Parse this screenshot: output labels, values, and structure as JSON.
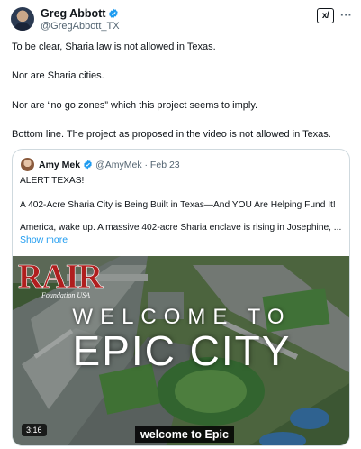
{
  "author": {
    "display_name": "Greg Abbott",
    "handle": "@GregAbbott_TX"
  },
  "toolbar": {
    "grok_icon": "grok-icon",
    "more_icon": "more-dots-icon",
    "grok_label": "x/",
    "more_label": "···"
  },
  "post": {
    "paragraphs": [
      "To be clear, Sharia law is not allowed in Texas.",
      "Nor are Sharia cities.",
      "Nor are “no go zones” which this project seems to imply.",
      "Bottom line. The project as proposed in the video is not allowed in Texas."
    ]
  },
  "quote": {
    "display_name": "Amy Mek",
    "handle_time": "@AmyMek · Feb 23",
    "lines": [
      "ALERT TEXAS!",
      "A 402-Acre Sharia City is Being Built in Texas—And YOU Are Helping Fund It!",
      "America, wake up. A massive 402-acre Sharia enclave is rising in Josephine, ..."
    ],
    "show_more": "Show more"
  },
  "video": {
    "logo_text": "RAIR",
    "logo_sub": "Foundation USA",
    "overlay_line1": "WELCOME TO",
    "overlay_line2": "EPIC CITY",
    "duration": "3:16",
    "caption": "welcome to Epic"
  },
  "colors": {
    "verified_blue": "#1d9bf0",
    "link_blue": "#1d9bf0",
    "text": "#0f1419",
    "muted": "#536471",
    "border": "#cfd9de"
  }
}
